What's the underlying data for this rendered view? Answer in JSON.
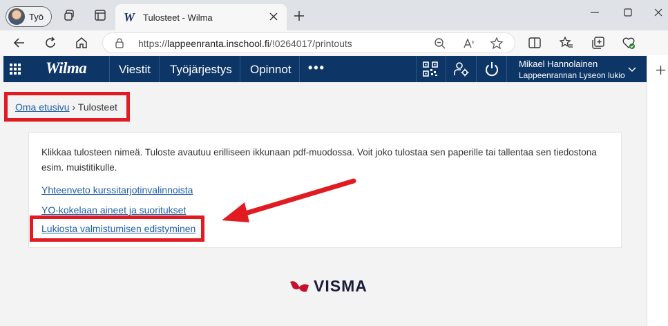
{
  "browser": {
    "profile_label": "Työ",
    "tab_title": "Tulosteet - Wilma",
    "tab_favicon": "W",
    "url_prefix": "https://",
    "url_host": "lappeenranta.inschool.fi",
    "url_path": "/!0264017/printouts"
  },
  "wilma": {
    "logo": "Wilma",
    "nav": [
      "Viestit",
      "Työjärjestys",
      "Opinnot"
    ],
    "more": "•••",
    "user_name": "Mikael Hannolainen",
    "school": "Lappeenrannan Lyseon lukio"
  },
  "breadcrumb": {
    "home": "Oma etusivu",
    "separator": "›",
    "current": "Tulosteet"
  },
  "content": {
    "intro": "Klikkaa tulosteen nimeä. Tuloste avautuu erilliseen ikkunaan pdf-muodossa. Voit joko tulostaa sen paperille tai tallentaa sen tiedostona esim. muistitikulle.",
    "links": [
      "Yhteenveto kurssitarjotinvalinnoista",
      "YO-kokelaan aineet ja suoritukset",
      "Lukiosta valmistumisen edistyminen"
    ]
  },
  "footer": {
    "brand": "VISMA"
  },
  "colors": {
    "wilma_navy": "#0d3666",
    "link_blue": "#1f5fa6",
    "highlight_red": "#e01b22",
    "visma_red": "#c8102e"
  }
}
